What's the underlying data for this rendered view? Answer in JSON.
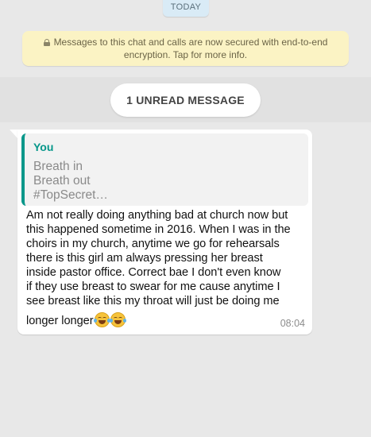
{
  "date_chip": {
    "label": "TODAY"
  },
  "encryption_notice": {
    "icon": "lock-icon",
    "line1": "Messages to this chat and calls are now secured with end-to-end",
    "line2": "encryption. Tap for more info."
  },
  "unread": {
    "label": "1 UNREAD MESSAGE"
  },
  "message": {
    "quote": {
      "author": "You",
      "lines": [
        "Breath in",
        "Breath out",
        "#TopSecret…"
      ],
      "accent_color": "#07978a"
    },
    "lines": [
      "Am not really doing anything bad at church now but",
      "this happened sometime in 2016. When I was in the",
      "choirs in my church, anytime we go for rehearsals",
      "there is this girl am always pressing her breast",
      "inside pastor office. Correct bae I don't even know",
      "if they use breast to swear for me cause anytime I",
      "see breast like this my throat will just be doing me",
      "longer longer"
    ],
    "emojis": [
      "face-with-tears-of-joy-icon",
      "face-with-tears-of-joy-icon"
    ],
    "time": "08:04"
  }
}
